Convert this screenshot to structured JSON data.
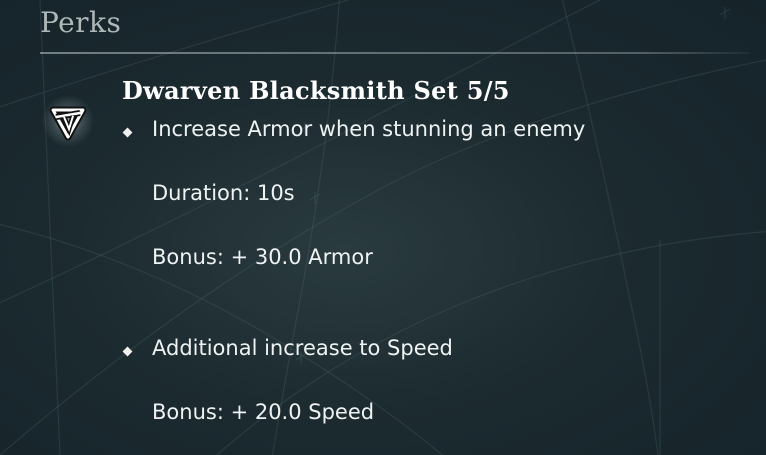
{
  "section": {
    "title": "Perks"
  },
  "perk": {
    "icon": "dwarven-rune-icon",
    "name": "Dwarven Blacksmith Set 5/5",
    "effects": [
      {
        "description": "Increase Armor when stunning an enemy",
        "details": [
          "Duration: 10s",
          "Bonus: + 30.0 Armor"
        ]
      },
      {
        "description": "Additional increase to Speed",
        "details": [
          "Bonus: + 20.0 Speed"
        ]
      }
    ]
  },
  "colors": {
    "background": "#1c2b30",
    "title_text": "#aeb8b8",
    "body_text": "#eef2f2"
  }
}
